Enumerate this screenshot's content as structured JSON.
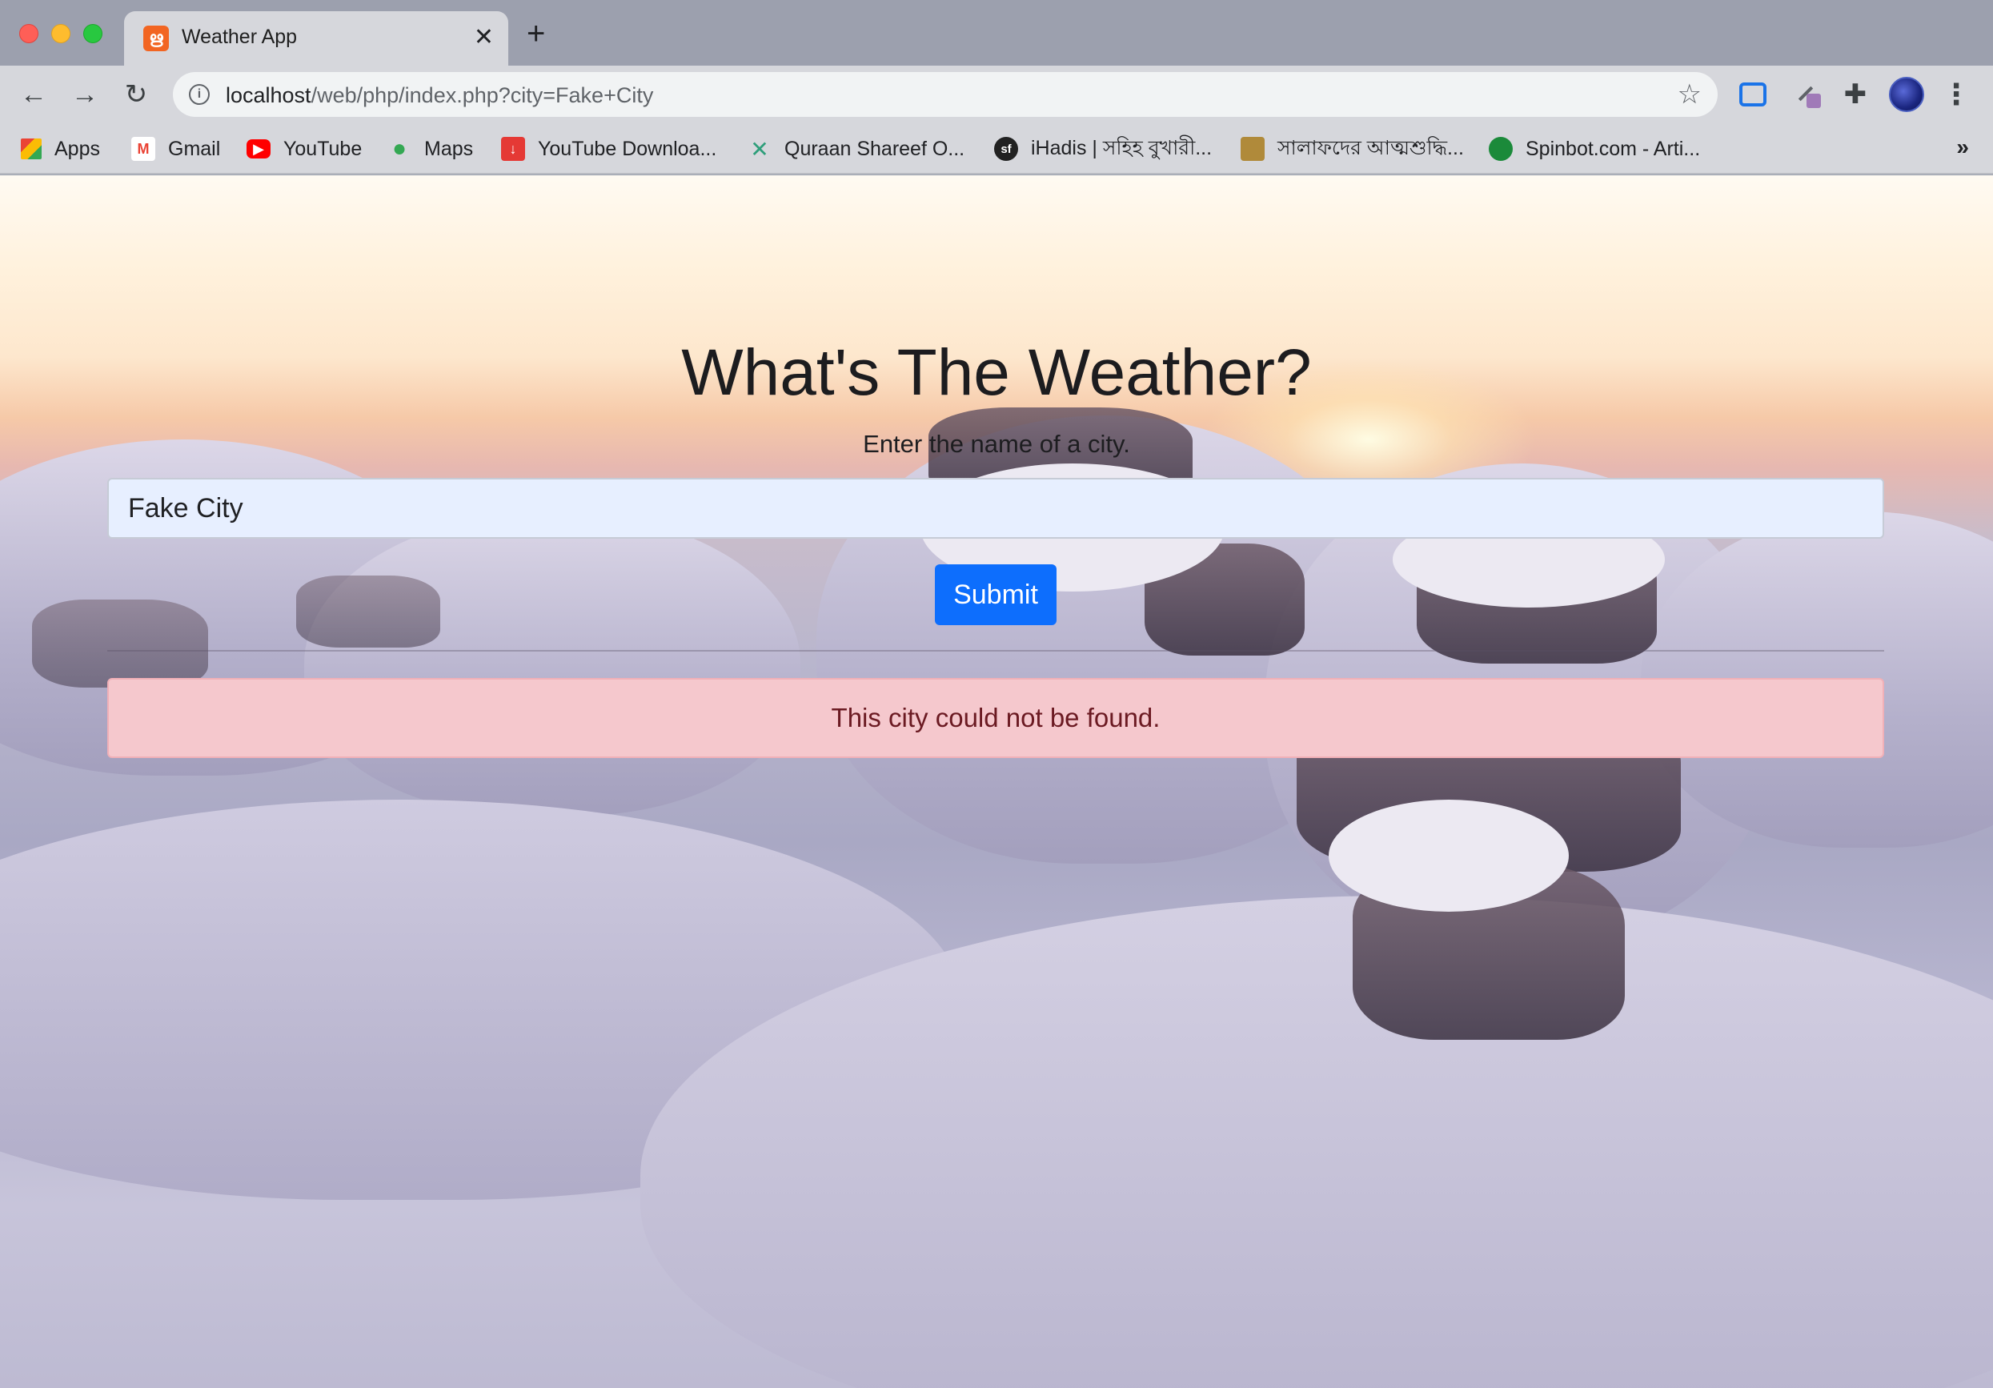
{
  "browser": {
    "tab_title": "Weather App",
    "new_tab_symbol": "+",
    "close_symbol": "✕",
    "url_host": "localhost",
    "url_path": "/web/php/index.php?city=Fake+City",
    "bookmarks": [
      {
        "label": "Apps",
        "icon": "apps-grid-icon",
        "color": "#ea4335"
      },
      {
        "label": "Gmail",
        "icon": "gmail-icon",
        "color": "#ea4335"
      },
      {
        "label": "YouTube",
        "icon": "youtube-icon",
        "color": "#ff0000"
      },
      {
        "label": "Maps",
        "icon": "maps-pin-icon",
        "color": "#34a853"
      },
      {
        "label": "YouTube Downloa...",
        "icon": "download-icon",
        "color": "#e53935"
      },
      {
        "label": "Quraan Shareef O...",
        "icon": "bird-icon",
        "color": "#2e9e7a"
      },
      {
        "label": "iHadis | সহিহ বুখারী...",
        "icon": "sf-logo-icon",
        "color": "#222222"
      },
      {
        "label": "সালাফদের আত্মশুদ্ধি...",
        "icon": "book-icon",
        "color": "#b08a3a"
      },
      {
        "label": "Spinbot.com - Arti...",
        "icon": "spinbot-icon",
        "color": "#1b8a3a"
      }
    ],
    "more_bookmarks": "»"
  },
  "page": {
    "title": "What's The Weather?",
    "subtitle": "Enter the name of a city.",
    "city_input_value": "Fake City",
    "submit_label": "Submit",
    "error_message": "This city could not be found."
  },
  "colors": {
    "submit_bg": "#0d6efd",
    "alert_bg": "#f5c8cd",
    "alert_text": "#6b1a22",
    "input_bg": "#e7efff"
  }
}
